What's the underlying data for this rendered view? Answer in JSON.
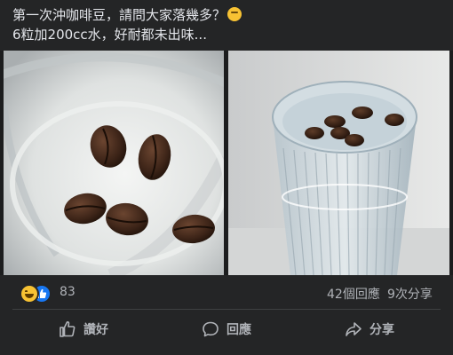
{
  "post": {
    "line1": "第一次沖咖啡豆，請問大家落幾多？",
    "line2": "6粒加200cc水，好耐都未出味..."
  },
  "photos": {
    "left_icon": "coffee-beans-in-cup-closeup",
    "right_icon": "coffee-beans-floating-in-glass"
  },
  "stats": {
    "reaction_count": "83",
    "comment_count": "42個回應",
    "share_count": "9次分享"
  },
  "actions": {
    "like_label": "讚好",
    "comment_label": "回應",
    "share_label": "分享"
  },
  "colors": {
    "background": "#242526",
    "text": "#e4e6eb",
    "muted": "#b0b3b8",
    "like_blue": "#1877f2",
    "haha_yellow": "#f7c233"
  }
}
